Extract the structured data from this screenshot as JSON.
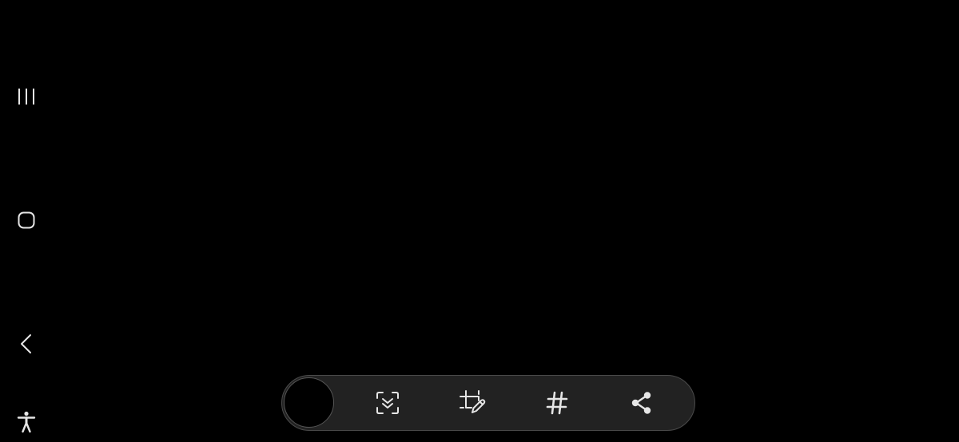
{
  "colors": {
    "background": "#000000",
    "toolbar_bg": "#222222",
    "toolbar_border": "#4a4a4a",
    "icon": "#e6e6e6"
  },
  "nav_bar": {
    "items": [
      {
        "icon": "recents-icon"
      },
      {
        "icon": "home-icon"
      },
      {
        "icon": "back-icon"
      },
      {
        "icon": "accessibility-icon"
      }
    ]
  },
  "screenshot_toolbar": {
    "thumbnail": {
      "icon": "screenshot-thumbnail"
    },
    "actions": [
      {
        "icon": "scroll-capture-icon"
      },
      {
        "icon": "draw-crop-icon"
      },
      {
        "icon": "hashtag-icon"
      },
      {
        "icon": "share-icon"
      }
    ]
  }
}
